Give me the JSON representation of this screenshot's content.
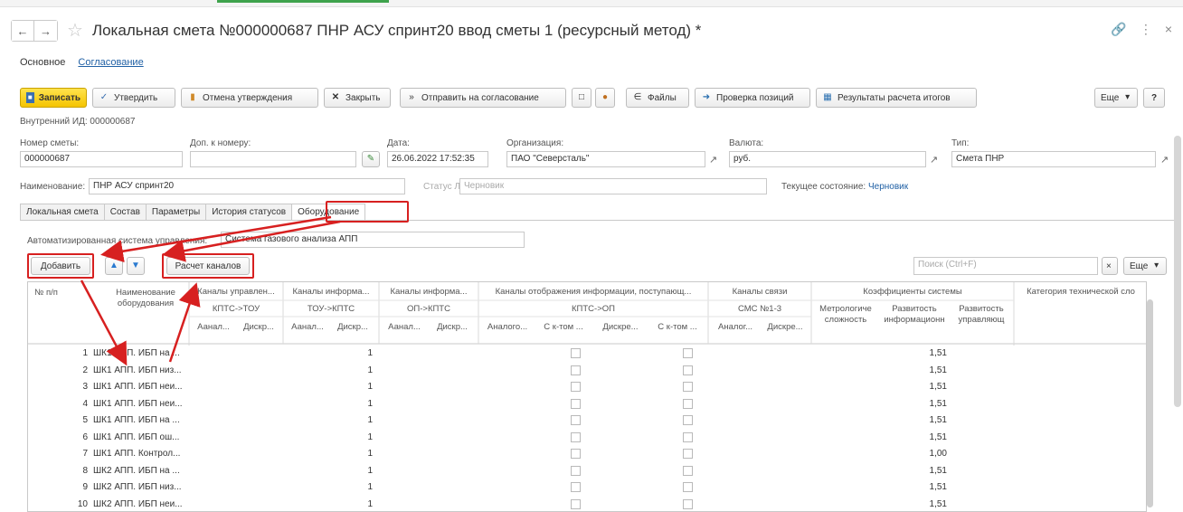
{
  "window": {
    "title": "Локальная смета №000000687 ПНР АСУ спринт20 ввод сметы 1 (ресурсный метод)",
    "modified_marker": "*"
  },
  "form_tabs": [
    "Основное",
    "Согласование"
  ],
  "toolbar": {
    "save": "Записать",
    "approve": "Утвердить",
    "cancel_approval": "Отмена утверждения",
    "close": "Закрыть",
    "send": "Отправить на согласование",
    "files": "Файлы",
    "check_positions": "Проверка позиций",
    "results": "Результаты расчета итогов",
    "more": "Еще",
    "help": "?"
  },
  "internal_id": "Внутренний ИД: 000000687",
  "header_fields": {
    "number_label": "Номер сметы:",
    "number": "000000687",
    "addon_label": "Доп. к номеру:",
    "addon": "",
    "date_label": "Дата:",
    "date": "26.06.2022 17:52:35",
    "org_label": "Организация:",
    "org": "ПАО \"Северсталь\"",
    "currency_label": "Валюта:",
    "currency": "руб.",
    "type_label": "Тип:",
    "type": "Смета ПНР",
    "name_label": "Наименование:",
    "name": "ПНР АСУ спринт20",
    "status_label": "Статус ЛС:",
    "status": "Черновик",
    "state_label": "Текущее состояние:",
    "state": "Черновик"
  },
  "doc_tabs": [
    "Локальная смета",
    "Состав",
    "Параметры",
    "История статусов",
    "Оборудование"
  ],
  "equipment": {
    "asu_label": "Автоматизированная система управления:",
    "asu_value": "Система газового анализа АПП",
    "add_button": "Добавить",
    "calc_button": "Расчет каналов",
    "search_placeholder": "Поиск (Ctrl+F)",
    "clear": "×",
    "more": "Еще"
  },
  "grid_headers": {
    "num": "№ п/п",
    "name": "Наименование оборудования",
    "g1": "Каналы управлен...",
    "g1s": "КПТС->ТОУ",
    "g2": "Каналы информа...",
    "g2s": "ТОУ->КПТС",
    "g3": "Каналы информа...",
    "g3s": "ОП->КПТС",
    "g4": "Каналы отображения информации, поступающ...",
    "g4s": "КПТС->ОП",
    "g5": "Каналы связи",
    "g5s": "СМС №1-3",
    "g6": "Коэффициенты системы",
    "g7": "Категория технической сло",
    "sub": [
      "Аанал...",
      "Дискр...",
      "Аанал...",
      "Дискр...",
      "Аанал...",
      "Дискр...",
      "Аналого...",
      "С к-том ...",
      "Дискре...",
      "С к-том ...",
      "Аналог...",
      "Дискре..."
    ],
    "k1": "Метрологиче сложность",
    "k2": "Развитость информационн",
    "k3": "Развитость управляющ"
  },
  "rows": [
    {
      "n": "1",
      "name": "ШК1 АПП. ИБП на ...",
      "ch": "1",
      "k": "1,51"
    },
    {
      "n": "2",
      "name": "ШК1 АПП. ИБП низ...",
      "ch": "1",
      "k": "1,51"
    },
    {
      "n": "3",
      "name": "ШК1 АПП. ИБП неи...",
      "ch": "1",
      "k": "1,51"
    },
    {
      "n": "4",
      "name": "ШК1 АПП. ИБП неи...",
      "ch": "1",
      "k": "1,51"
    },
    {
      "n": "5",
      "name": "ШК1 АПП. ИБП на ...",
      "ch": "1",
      "k": "1,51"
    },
    {
      "n": "6",
      "name": "ШК1 АПП. ИБП ош...",
      "ch": "1",
      "k": "1,51"
    },
    {
      "n": "7",
      "name": "ШК1 АПП. Контрол...",
      "ch": "1",
      "k": "1,00"
    },
    {
      "n": "8",
      "name": "ШК2 АПП. ИБП на ...",
      "ch": "1",
      "k": "1,51"
    },
    {
      "n": "9",
      "name": "ШК2 АПП. ИБП низ...",
      "ch": "1",
      "k": "1,51"
    },
    {
      "n": "10",
      "name": "ШК2 АПП. ИБП неи...",
      "ch": "1",
      "k": "1,51"
    }
  ],
  "colors": {
    "accent_yellow": "#f5c400",
    "link": "#2161a5",
    "highlight": "#d72020"
  }
}
